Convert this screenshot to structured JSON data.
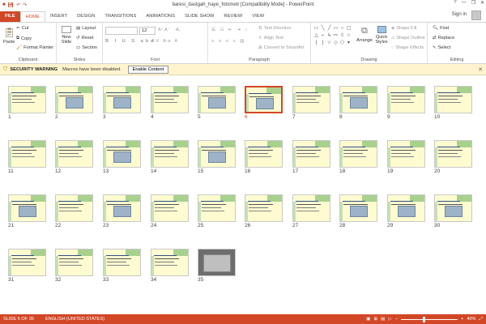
{
  "window": {
    "title": "baresi_dastgah_haye_fotometr [Compatibility Mode] - PowerPoint",
    "sign_in": "Sign in"
  },
  "tabs": [
    "FILE",
    "HOME",
    "INSERT",
    "DESIGN",
    "TRANSITIONS",
    "ANIMATIONS",
    "SLIDE SHOW",
    "REVIEW",
    "VIEW"
  ],
  "ribbon": {
    "clipboard": {
      "paste": "Paste",
      "cut": "Cut",
      "copy": "Copy",
      "format_painter": "Format Painter",
      "label": "Clipboard"
    },
    "slides": {
      "new_slide": "New Slide",
      "layout": "Layout",
      "reset": "Reset",
      "section": "Section",
      "label": "Slides"
    },
    "font": {
      "size": "12",
      "label": "Font"
    },
    "paragraph": {
      "text_direction": "Text Direction",
      "align_text": "Align Text",
      "convert": "Convert to SmartArt",
      "label": "Paragraph"
    },
    "drawing": {
      "arrange": "Arrange",
      "quick_styles": "Quick Styles",
      "shape_fill": "Shape Fill",
      "shape_outline": "Shape Outline",
      "shape_effects": "Shape Effects",
      "label": "Drawing"
    },
    "editing": {
      "find": "Find",
      "replace": "Replace",
      "select": "Select",
      "label": "Editing"
    }
  },
  "security": {
    "title": "SECURITY WARNING",
    "message": "Macros have been disabled.",
    "button": "Enable Content"
  },
  "slides": {
    "count": 35,
    "selected": 6,
    "photo_slide": 35,
    "image_slides": [
      2,
      3,
      5,
      6,
      8,
      13,
      15,
      21,
      23,
      28,
      29,
      30,
      35
    ]
  },
  "status": {
    "slide_info": "SLIDE 6 OF 35",
    "language": "ENGLISH (UNITED STATES)",
    "zoom": "40%",
    "zoom_level": 0.4
  },
  "colors": {
    "accent": "#d24726",
    "slide_bg": "#fefbd0",
    "band": "#a9d18e"
  },
  "icons": [
    "save-icon",
    "undo-icon",
    "redo-icon",
    "help-icon",
    "minimize-icon",
    "restore-icon",
    "close-icon",
    "shield-icon"
  ]
}
